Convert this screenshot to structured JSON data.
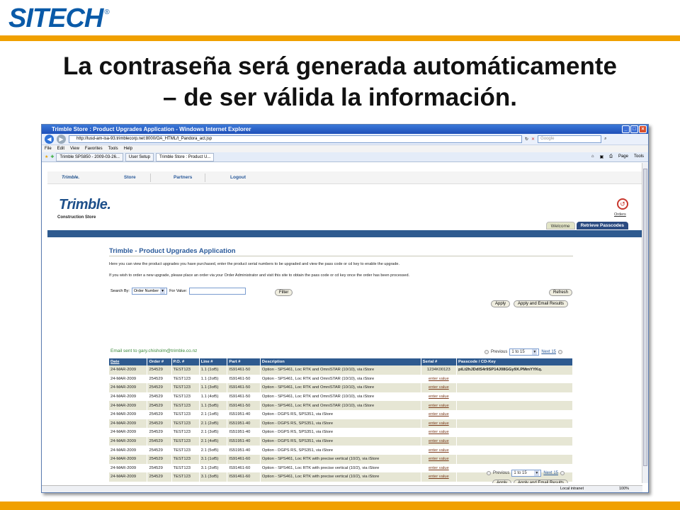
{
  "slide": {
    "logo": "SITECH",
    "headline_line1": "La contraseña será generada automáticamente",
    "headline_line2": "– de ser válida la información.",
    "colors": {
      "brand_blue": "#0a5aa8",
      "accent_orange": "#f0a000"
    }
  },
  "browser": {
    "title": "Trimble Store : Product Upgrades Application - Windows Internet Explorer",
    "url": "http://lusd-am-isa-93.trimblecorp.net:8000/OA_HTML/t_Pandora_act.jsp",
    "search_placeholder": "Google",
    "menu": [
      "File",
      "Edit",
      "View",
      "Favorites",
      "Tools",
      "Help"
    ],
    "tabs": [
      "Trimble SPS850 - 2009-03-26...",
      "User Setup",
      "Trimble Store : Product U..."
    ],
    "toolbar_right": [
      "Page",
      "Tools"
    ],
    "status_zone": "Local intranet",
    "zoom": "100%"
  },
  "site": {
    "nav_logo": "Trimble.",
    "nav": [
      "Store",
      "Partners",
      "Logout"
    ],
    "logo": "Trimble.",
    "store_label": "Construction Store",
    "orders_label": "Orders",
    "subtabs": [
      "Welcome",
      "Retrieve Passcodes"
    ]
  },
  "page": {
    "title": "Trimble - Product Upgrades Application",
    "intro": "Here you can view the product upgrades you have purchased, enter the product serial numbers to be upgraded and view the pass code or cd key to enable the upgrade.",
    "intro2": "If you wish to order a new upgrade, please place an order via your Order Administrator and visit this site to obtain the pass code or cd key once the order has been processed.",
    "search_by_label": "Search By:",
    "search_by_value": "Order Number",
    "for_value_label": "For Value:",
    "filter_button": "Filter",
    "refresh_button": "Refresh",
    "apply_button": "Apply",
    "apply_email_button": "Apply and Email Results",
    "email_notice": "Email sent to gary.chisholm@trimble.co.nz",
    "pager_previous": "Previous",
    "pager_range": "1 to 15",
    "pager_next": "Next 15"
  },
  "table": {
    "columns": [
      "Date",
      "Order #",
      "P.O. #",
      "Line #",
      "Part #",
      "Description",
      "Serial #",
      "Passcode / CD-Key"
    ],
    "rows": [
      [
        "24-MAR-2009",
        "254529",
        "TEST123",
        "1.1 (1of5)",
        "IS91461-50",
        "Option - SPS461, Loc RTK and OmniSTAR (10/10), via iStore",
        "1234K00123",
        "piLt2hJDdlS4r9SP14J08GGy9X.PMmYYKq."
      ],
      [
        "24-MAR-2009",
        "254529",
        "TEST123",
        "1.1 (2of5)",
        "IS91461-50",
        "Option - SPS461, Loc RTK and OmniSTAR (10/10), via iStore",
        "enter value",
        ""
      ],
      [
        "24-MAR-2009",
        "254529",
        "TEST123",
        "1.1 (3of5)",
        "IS91461-50",
        "Option - SPS461, Loc RTK and OmniSTAR (10/10), via iStore",
        "enter value",
        ""
      ],
      [
        "24-MAR-2009",
        "254529",
        "TEST123",
        "1.1 (4of5)",
        "IS91461-50",
        "Option - SPS461, Loc RTK and OmniSTAR (10/10), via iStore",
        "enter value",
        ""
      ],
      [
        "24-MAR-2009",
        "254529",
        "TEST123",
        "1.1 (5of5)",
        "IS91461-50",
        "Option - SPS461, Loc RTK and OmniSTAR (10/10), via iStore",
        "enter value",
        ""
      ],
      [
        "24-MAR-2009",
        "254529",
        "TEST123",
        "2.1 (1of5)",
        "IS51951-40",
        "Option - DGPS RS, SPS351, via iStore",
        "enter value",
        ""
      ],
      [
        "24-MAR-2009",
        "254529",
        "TEST123",
        "2.1 (2of5)",
        "IS51951-40",
        "Option - DGPS RS, SPS351, via iStore",
        "enter value",
        ""
      ],
      [
        "24-MAR-2009",
        "254529",
        "TEST123",
        "2.1 (3of5)",
        "IS51951-40",
        "Option - DGPS RS, SPS351, via iStore",
        "enter value",
        ""
      ],
      [
        "24-MAR-2009",
        "254529",
        "TEST123",
        "2.1 (4of5)",
        "IS51951-40",
        "Option - DGPS RS, SPS351, via iStore",
        "enter value",
        ""
      ],
      [
        "24-MAR-2009",
        "254529",
        "TEST123",
        "2.1 (5of5)",
        "IS51951-40",
        "Option - DGPS RS, SPS351, via iStore",
        "enter value",
        ""
      ],
      [
        "24-MAR-2009",
        "254529",
        "TEST123",
        "3.1 (1of5)",
        "IS91461-60",
        "Option - SPS461, Loc RTK with precise vertical (10/2), via iStore",
        "enter value",
        ""
      ],
      [
        "24-MAR-2009",
        "254529",
        "TEST123",
        "3.1 (2of5)",
        "IS91461-60",
        "Option - SPS461, Loc RTK with precise vertical (10/2), via iStore",
        "enter value",
        ""
      ],
      [
        "24-MAR-2009",
        "254529",
        "TEST123",
        "3.1 (3of5)",
        "IS91461-60",
        "Option - SPS461, Loc RTK with precise vertical (10/2), via iStore",
        "enter value",
        ""
      ],
      [
        "24-MAR-2009",
        "254529",
        "TEST123",
        "3.1 (4of5)",
        "IS91461-60",
        "Option - SPS461, Loc RTK with precise vertical (10/2), via iStore",
        "enter value",
        ""
      ],
      [
        "24-MAR-2009",
        "254529",
        "TEST123",
        "3.1 (5of5)",
        "IS91461-60",
        "Option - SPS461, Loc RTK with precise vertical (10/2), via iStore",
        "enter value",
        ""
      ]
    ]
  }
}
